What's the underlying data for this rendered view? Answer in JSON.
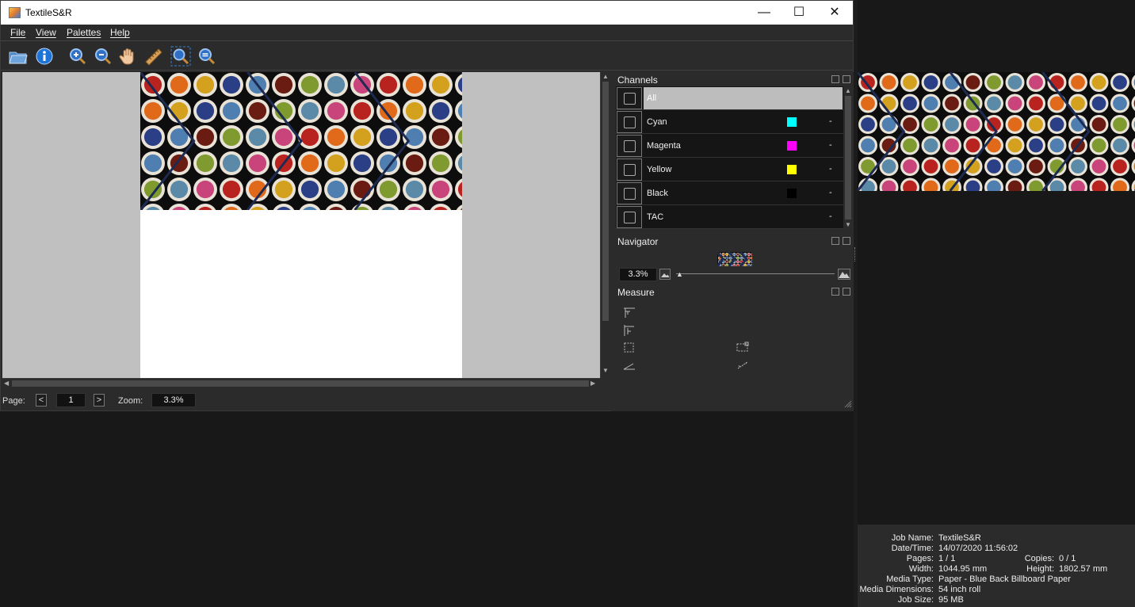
{
  "window": {
    "title": "TextileS&R",
    "controls": {
      "minimize": "—",
      "maximize": "☐",
      "close": "✕"
    }
  },
  "menu": [
    "File",
    "View",
    "Palettes",
    "Help"
  ],
  "toolbar": [
    "open-folder-icon",
    "info-icon",
    "zoom-in-icon",
    "zoom-out-icon",
    "pan-hand-icon",
    "ruler-icon",
    "zoom-fit-icon",
    "zoom-actual-icon"
  ],
  "status": {
    "page_label": "Page:",
    "prev": "<",
    "page_value": "1",
    "next": ">",
    "zoom_label": "Zoom:",
    "zoom_value": "3.3%"
  },
  "panels": {
    "channels": {
      "title": "Channels",
      "rows": [
        {
          "label": "All",
          "color": "",
          "dash": ""
        },
        {
          "label": "Cyan",
          "color": "#00ffff",
          "dash": "-"
        },
        {
          "label": "Magenta",
          "color": "#ff00ff",
          "dash": "-"
        },
        {
          "label": "Yellow",
          "color": "#ffff00",
          "dash": "-"
        },
        {
          "label": "Black",
          "color": "#000000",
          "dash": "-"
        },
        {
          "label": "TAC",
          "color": "",
          "dash": "-"
        }
      ]
    },
    "navigator": {
      "title": "Navigator",
      "zoom": "3.3%",
      "slider_fraction": 0.0
    },
    "measure": {
      "title": "Measure"
    }
  },
  "job_info": [
    {
      "label": "Job Name:",
      "value": "TextileS&R"
    },
    {
      "label": "Date/Time:",
      "value": "14/07/2020 11:56:02"
    },
    {
      "label": "Pages:",
      "value": "1 / 1",
      "label2": "Copies:",
      "value2": "0 / 1"
    },
    {
      "label": "Width:",
      "value": "1044.95 mm",
      "label2": "Height:",
      "value2": "1802.57 mm"
    },
    {
      "label": "Media Type:",
      "value": "Paper - Blue Back Billboard Paper"
    },
    {
      "label": "Media Dimensions:",
      "value": "54 inch roll"
    },
    {
      "label": "Job Size:",
      "value": "95 MB"
    }
  ],
  "colors": {
    "accent": "#2b2b2b",
    "dye_palette": [
      "#b8231f",
      "#d3a11d",
      "#4f7fb0",
      "#7f9a2e",
      "#c8447a",
      "#e0691a",
      "#2b3f87",
      "#6b1c12",
      "#5a8aa8"
    ]
  }
}
